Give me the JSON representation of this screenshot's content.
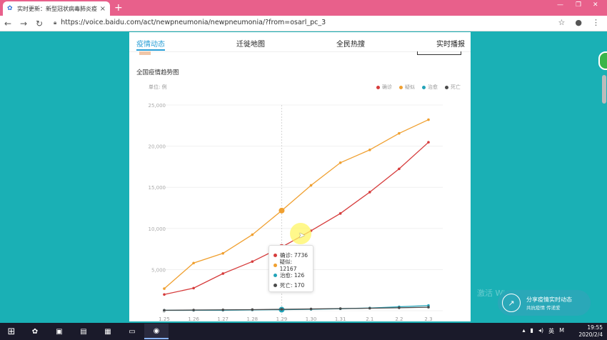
{
  "browser": {
    "tab_title": "实时更新：新型冠状病毒肺炎疫情",
    "tab_close": "×",
    "new_tab": "+",
    "url": "https://voice.baidu.com/act/newpneumonia/newpneumonia/?from=osarl_pc_3",
    "window_controls": [
      "—",
      "❐",
      "✕"
    ]
  },
  "nav": {
    "tabs": [
      "疫情动态",
      "迁徙地图",
      "全民热搜",
      "实时播报"
    ],
    "active": 0
  },
  "section": {
    "title": "全国疫情趋势图",
    "unit": "单位: 例"
  },
  "colors": {
    "confirmed": "#d63c3c",
    "suspected": "#f0a030",
    "cured": "#22a3b8",
    "dead": "#4a4a4a",
    "accent": "#2a9fd6"
  },
  "chart_data": {
    "type": "line",
    "categories": [
      "1.25",
      "1.26",
      "1.27",
      "1.28",
      "1.29",
      "1.30",
      "1.31",
      "2.1",
      "2.2",
      "2.3"
    ],
    "yticks": [
      "0",
      "5,000",
      "10,000",
      "15,000",
      "20,000",
      "25,000"
    ],
    "ylim": [
      0,
      25000
    ],
    "grid": true,
    "legend_position": "top-right",
    "series": [
      {
        "name": "确诊",
        "values": [
          1975,
          2744,
          4515,
          5974,
          7736,
          9720,
          11821,
          14411,
          17238,
          20471
        ]
      },
      {
        "name": "疑似",
        "values": [
          2684,
          5794,
          6973,
          9239,
          12167,
          15238,
          17988,
          19544,
          21558,
          23214
        ]
      },
      {
        "name": "治愈",
        "values": [
          49,
          51,
          60,
          103,
          126,
          171,
          243,
          328,
          475,
          632
        ]
      },
      {
        "name": "死亡",
        "values": [
          56,
          80,
          106,
          132,
          170,
          213,
          259,
          304,
          361,
          425
        ]
      }
    ],
    "hover_index": 4
  },
  "tooltip": {
    "rows": [
      {
        "label": "确诊: 7736"
      },
      {
        "label": "疑似: 12167"
      },
      {
        "label": "治愈: 126"
      },
      {
        "label": "死亡: 170"
      }
    ]
  },
  "share": {
    "title": "分享疫情实时动态",
    "subtitle": "共抗疫情 传递爱"
  },
  "watermark": "激活 Windows",
  "taskbar": {
    "tray_lang": "英",
    "tray_ime": "M",
    "time": "19:55",
    "date": "2020/2/4"
  }
}
